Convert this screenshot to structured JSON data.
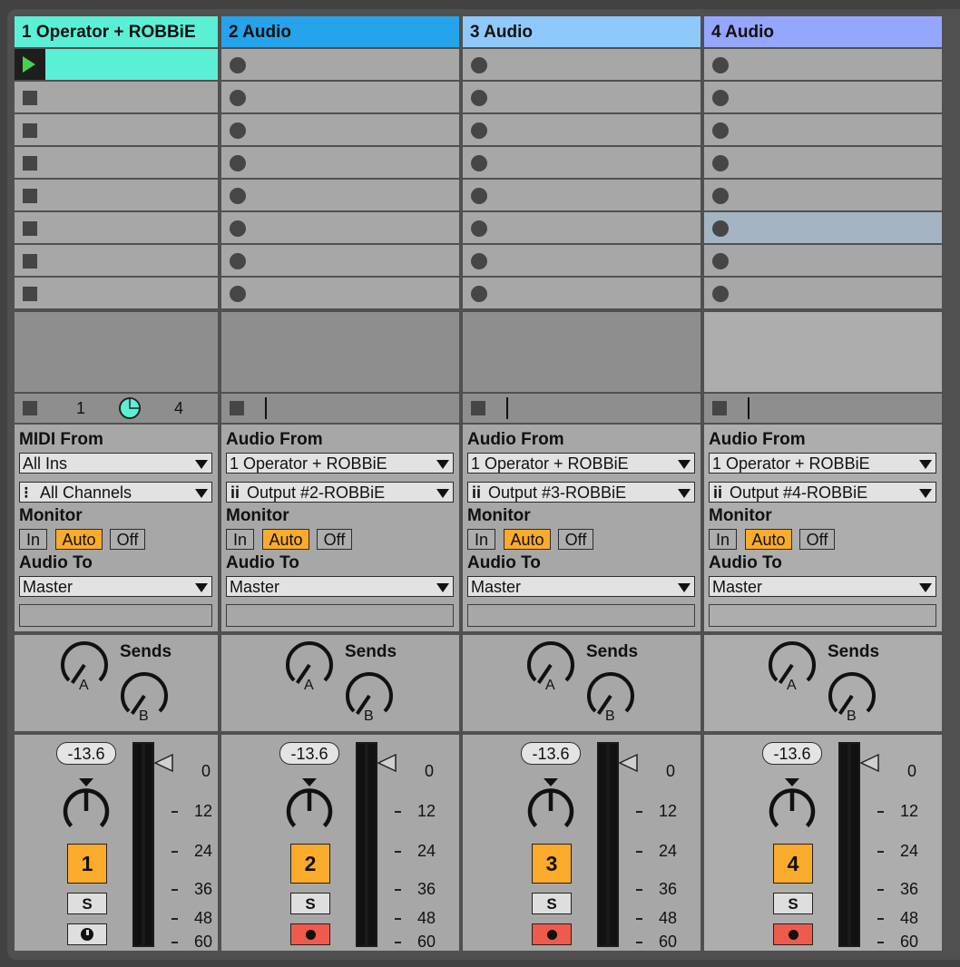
{
  "colors": {
    "track1": "#5bf0d6",
    "track2": "#25a3eb",
    "track3": "#8fc9fb",
    "track4": "#94a6fd",
    "arm": "#fbab2c",
    "rec": "#ee5b4c"
  },
  "tracks": [
    {
      "name": "1 Operator + ROBBiE",
      "input_label": "MIDI From",
      "input": "All Ins",
      "channel": "All Channels",
      "monitor_label": "Monitor",
      "monitor": [
        "In",
        "Auto",
        "Off"
      ],
      "output_label": "Audio To",
      "output": "Master",
      "sends_label": "Sends",
      "send_a": "A",
      "send_b": "B",
      "volume": "-13.6",
      "number": "1",
      "solo": "S",
      "meter_ticks": [
        "0",
        "12",
        "24",
        "36",
        "48",
        "60"
      ],
      "quantize_left": "1",
      "quantize_right": "4"
    },
    {
      "name": "2 Audio",
      "input_label": "Audio From",
      "input": "1 Operator + ROBBiE",
      "channel": "Output #2-ROBBiE",
      "monitor_label": "Monitor",
      "monitor": [
        "In",
        "Auto",
        "Off"
      ],
      "output_label": "Audio To",
      "output": "Master",
      "sends_label": "Sends",
      "send_a": "A",
      "send_b": "B",
      "volume": "-13.6",
      "number": "2",
      "solo": "S",
      "meter_ticks": [
        "0",
        "12",
        "24",
        "36",
        "48",
        "60"
      ]
    },
    {
      "name": "3 Audio",
      "input_label": "Audio From",
      "input": "1 Operator + ROBBiE",
      "channel": "Output #3-ROBBiE",
      "monitor_label": "Monitor",
      "monitor": [
        "In",
        "Auto",
        "Off"
      ],
      "output_label": "Audio To",
      "output": "Master",
      "sends_label": "Sends",
      "send_a": "A",
      "send_b": "B",
      "volume": "-13.6",
      "number": "3",
      "solo": "S",
      "meter_ticks": [
        "0",
        "12",
        "24",
        "36",
        "48",
        "60"
      ]
    },
    {
      "name": "4 Audio",
      "input_label": "Audio From",
      "input": "1 Operator + ROBBiE",
      "channel": "Output #4-ROBBiE",
      "monitor_label": "Monitor",
      "monitor": [
        "In",
        "Auto",
        "Off"
      ],
      "output_label": "Audio To",
      "output": "Master",
      "sends_label": "Sends",
      "send_a": "A",
      "send_b": "B",
      "volume": "-13.6",
      "number": "4",
      "solo": "S",
      "meter_ticks": [
        "0",
        "12",
        "24",
        "36",
        "48",
        "60"
      ]
    }
  ]
}
